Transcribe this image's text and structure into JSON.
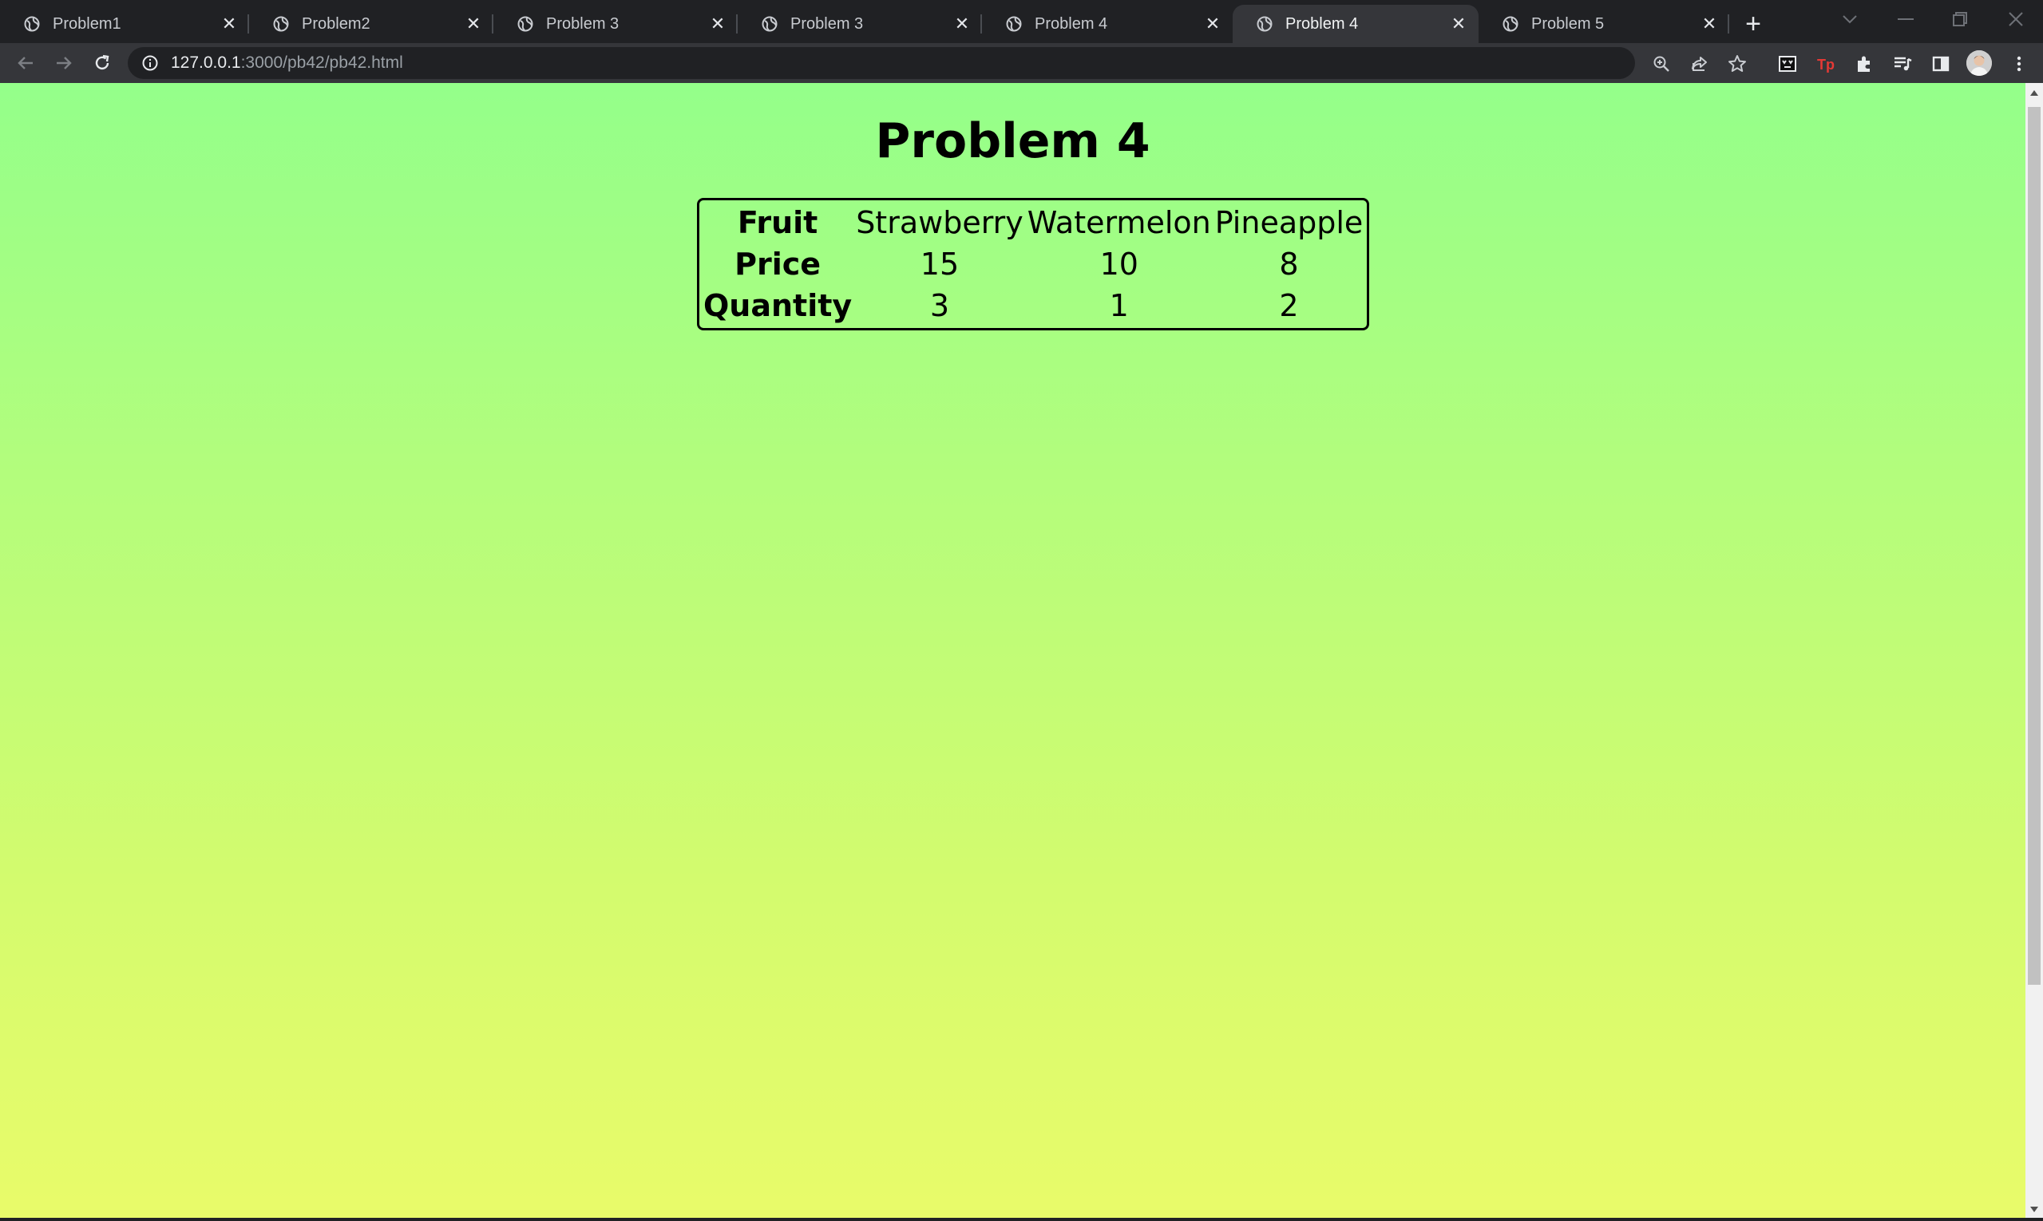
{
  "browser": {
    "tabs": [
      {
        "title": "Problem1",
        "active": false
      },
      {
        "title": "Problem2",
        "active": false
      },
      {
        "title": "Problem 3",
        "active": false
      },
      {
        "title": "Problem 3",
        "active": false
      },
      {
        "title": "Problem 4",
        "active": false
      },
      {
        "title": "Problem 4",
        "active": true
      },
      {
        "title": "Problem 5",
        "active": false
      }
    ],
    "new_tab_label": "+",
    "address": {
      "host": "127.0.0.1",
      "path": ":3000/pb42/pb42.html"
    }
  },
  "page": {
    "title": "Problem 4",
    "table": {
      "row_headers": [
        "Fruit",
        "Price",
        "Quantity"
      ],
      "fruits": [
        "Strawberry",
        "Watermelon",
        "Pineapple"
      ],
      "prices": [
        "15",
        "10",
        "8"
      ],
      "quantities": [
        "3",
        "1",
        "2"
      ]
    },
    "background_colors": [
      "#94ff8a",
      "#e9fb6a"
    ]
  }
}
